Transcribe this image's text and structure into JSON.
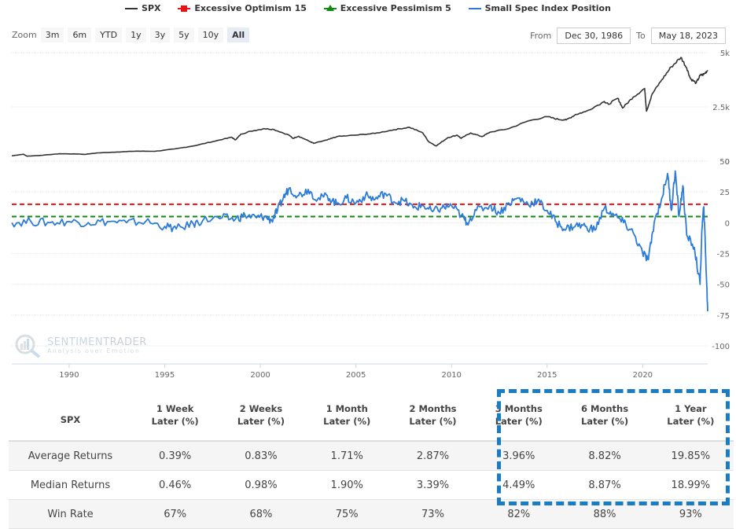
{
  "legend": [
    {
      "label": "SPX",
      "color": "#333333",
      "symbol": "line"
    },
    {
      "label": "Excessive Optimism 15",
      "color": "#ee1111",
      "symbol": "square"
    },
    {
      "label": "Excessive Pessimism 5",
      "color": "#118811",
      "symbol": "triangle"
    },
    {
      "label": "Small Spec Index Position",
      "color": "#2b7bd8",
      "symbol": "line"
    }
  ],
  "zoom": {
    "label": "Zoom",
    "buttons": [
      "3m",
      "6m",
      "YTD",
      "1y",
      "3y",
      "5y",
      "10y",
      "All"
    ],
    "selected": "All"
  },
  "range": {
    "from_label": "From",
    "from_value": "Dec 30, 1986",
    "to_label": "To",
    "to_value": "May 18, 2023"
  },
  "logo": {
    "brand_a": "SENTIMEN",
    "brand_b": "TRADER",
    "tagline": "Analysis over Emotion"
  },
  "chart_data": {
    "type": "line",
    "x_range": [
      1987.0,
      2023.4
    ],
    "x_ticks": [
      1990,
      1995,
      2000,
      2005,
      2010,
      2015,
      2020
    ],
    "panes": [
      {
        "name": "SPX",
        "y_ticks": [
          {
            "v": 0,
            "label": "0"
          },
          {
            "v": 2500,
            "label": "2.5k"
          },
          {
            "v": 5000,
            "label": "5k"
          }
        ],
        "ylim": [
          0,
          5000
        ],
        "series": [
          {
            "name": "SPX",
            "color": "#333333",
            "points": [
              [
                1987.0,
                245
              ],
              [
                1987.6,
                320
              ],
              [
                1987.8,
                230
              ],
              [
                1988.5,
                265
              ],
              [
                1989.5,
                340
              ],
              [
                1990.5,
                330
              ],
              [
                1990.8,
                310
              ],
              [
                1991.5,
                380
              ],
              [
                1992.5,
                420
              ],
              [
                1993.5,
                460
              ],
              [
                1994.5,
                455
              ],
              [
                1995.5,
                560
              ],
              [
                1996.5,
                700
              ],
              [
                1997.5,
                900
              ],
              [
                1998.5,
                1100
              ],
              [
                1998.7,
                980
              ],
              [
                1999.0,
                1250
              ],
              [
                1999.5,
                1380
              ],
              [
                2000.2,
                1500
              ],
              [
                2000.7,
                1460
              ],
              [
                2001.5,
                1200
              ],
              [
                2001.7,
                1050
              ],
              [
                2002.0,
                1150
              ],
              [
                2002.6,
                900
              ],
              [
                2002.8,
                820
              ],
              [
                2003.5,
                980
              ],
              [
                2004.0,
                1130
              ],
              [
                2005.0,
                1200
              ],
              [
                2006.0,
                1280
              ],
              [
                2007.0,
                1450
              ],
              [
                2007.8,
                1560
              ],
              [
                2008.5,
                1300
              ],
              [
                2008.8,
                900
              ],
              [
                2009.2,
                700
              ],
              [
                2009.8,
                1080
              ],
              [
                2010.3,
                1200
              ],
              [
                2010.5,
                1050
              ],
              [
                2011.0,
                1300
              ],
              [
                2011.6,
                1130
              ],
              [
                2012.0,
                1330
              ],
              [
                2013.0,
                1500
              ],
              [
                2014.0,
                1850
              ],
              [
                2015.0,
                2050
              ],
              [
                2015.6,
                1920
              ],
              [
                2016.0,
                1900
              ],
              [
                2016.5,
                2150
              ],
              [
                2017.0,
                2280
              ],
              [
                2018.0,
                2750
              ],
              [
                2018.2,
                2620
              ],
              [
                2018.7,
                2900
              ],
              [
                2018.95,
                2450
              ],
              [
                2019.5,
                2950
              ],
              [
                2020.1,
                3350
              ],
              [
                2020.2,
                2300
              ],
              [
                2020.5,
                3100
              ],
              [
                2021.0,
                3750
              ],
              [
                2021.5,
                4350
              ],
              [
                2022.0,
                4780
              ],
              [
                2022.3,
                4300
              ],
              [
                2022.5,
                3800
              ],
              [
                2022.8,
                3600
              ],
              [
                2023.0,
                3950
              ],
              [
                2023.2,
                4000
              ],
              [
                2023.4,
                4190
              ]
            ]
          }
        ]
      },
      {
        "name": "Small Spec Index Position",
        "y_ticks": [
          {
            "v": -100,
            "label": "-100"
          },
          {
            "v": -75,
            "label": "-75"
          },
          {
            "v": -50,
            "label": "-50"
          },
          {
            "v": -25,
            "label": "-25"
          },
          {
            "v": 0,
            "label": "0"
          },
          {
            "v": 25,
            "label": "25"
          },
          {
            "v": 50,
            "label": "50"
          }
        ],
        "ylim": [
          -100,
          50
        ],
        "thresholds": [
          {
            "name": "Excessive Optimism",
            "value": 15,
            "color": "#ee1111"
          },
          {
            "name": "Excessive Pessimism",
            "value": 5,
            "color": "#118811"
          }
        ],
        "series": [
          {
            "name": "Small Spec Index Position",
            "color": "#2b7bd8",
            "points": [
              [
                1987.0,
                0
              ],
              [
                1988.0,
                1
              ],
              [
                1989.0,
                0
              ],
              [
                1990.0,
                1
              ],
              [
                1991.0,
                0
              ],
              [
                1992.0,
                1
              ],
              [
                1993.0,
                0
              ],
              [
                1994.0,
                1
              ],
              [
                1995.0,
                -3
              ],
              [
                1995.6,
                -5
              ],
              [
                1996.5,
                -1
              ],
              [
                1997.0,
                2
              ],
              [
                1998.0,
                4
              ],
              [
                1998.7,
                3
              ],
              [
                1999.2,
                6
              ],
              [
                1999.8,
                4
              ],
              [
                2000.2,
                5
              ],
              [
                2000.6,
                2
              ],
              [
                2000.9,
                10
              ],
              [
                2001.2,
                20
              ],
              [
                2001.5,
                28
              ],
              [
                2002.0,
                22
              ],
              [
                2002.5,
                27
              ],
              [
                2003.0,
                19
              ],
              [
                2003.5,
                22
              ],
              [
                2004.0,
                15
              ],
              [
                2004.5,
                20
              ],
              [
                2005.0,
                16
              ],
              [
                2005.5,
                22
              ],
              [
                2006.0,
                19
              ],
              [
                2006.5,
                24
              ],
              [
                2007.0,
                17
              ],
              [
                2007.5,
                18
              ],
              [
                2008.0,
                12
              ],
              [
                2008.5,
                14
              ],
              [
                2009.0,
                9
              ],
              [
                2009.5,
                12
              ],
              [
                2010.0,
                14
              ],
              [
                2010.5,
                6
              ],
              [
                2010.8,
                0
              ],
              [
                2011.3,
                10
              ],
              [
                2012.0,
                14
              ],
              [
                2012.5,
                8
              ],
              [
                2013.0,
                16
              ],
              [
                2013.5,
                20
              ],
              [
                2014.0,
                15
              ],
              [
                2014.5,
                18
              ],
              [
                2015.0,
                10
              ],
              [
                2015.5,
                0
              ],
              [
                2016.0,
                -5
              ],
              [
                2016.5,
                -2
              ],
              [
                2017.0,
                -3
              ],
              [
                2017.5,
                -6
              ],
              [
                2018.0,
                12
              ],
              [
                2018.5,
                6
              ],
              [
                2019.0,
                0
              ],
              [
                2019.5,
                -8
              ],
              [
                2020.0,
                -25
              ],
              [
                2020.3,
                -30
              ],
              [
                2020.6,
                0
              ],
              [
                2021.0,
                20
              ],
              [
                2021.3,
                40
              ],
              [
                2021.5,
                10
              ],
              [
                2021.7,
                42
              ],
              [
                2021.9,
                5
              ],
              [
                2022.1,
                30
              ],
              [
                2022.3,
                -10
              ],
              [
                2022.7,
                -20
              ],
              [
                2023.0,
                -50
              ],
              [
                2023.1,
                -5
              ],
              [
                2023.2,
                13
              ],
              [
                2023.3,
                -30
              ],
              [
                2023.4,
                -72
              ]
            ]
          }
        ]
      }
    ]
  },
  "table": {
    "headers": [
      {
        "line1": "SPX",
        "line2": ""
      },
      {
        "line1": "1 Week",
        "line2": "Later (%)"
      },
      {
        "line1": "2 Weeks",
        "line2": "Later (%)"
      },
      {
        "line1": "1 Month",
        "line2": "Later (%)"
      },
      {
        "line1": "2 Months",
        "line2": "Later (%)"
      },
      {
        "line1": "3 Months",
        "line2": "Later (%)"
      },
      {
        "line1": "6 Months",
        "line2": "Later (%)"
      },
      {
        "line1": "1 Year",
        "line2": "Later (%)"
      }
    ],
    "rows": [
      [
        "Average Returns",
        "0.39%",
        "0.83%",
        "1.71%",
        "2.87%",
        "3.96%",
        "8.82%",
        "19.85%"
      ],
      [
        "Median Returns",
        "0.46%",
        "0.98%",
        "1.90%",
        "3.39%",
        "4.49%",
        "8.87%",
        "18.99%"
      ],
      [
        "Win Rate",
        "67%",
        "68%",
        "75%",
        "73%",
        "82%",
        "88%",
        "93%"
      ]
    ],
    "highlight_color": "#1a7dc4"
  }
}
